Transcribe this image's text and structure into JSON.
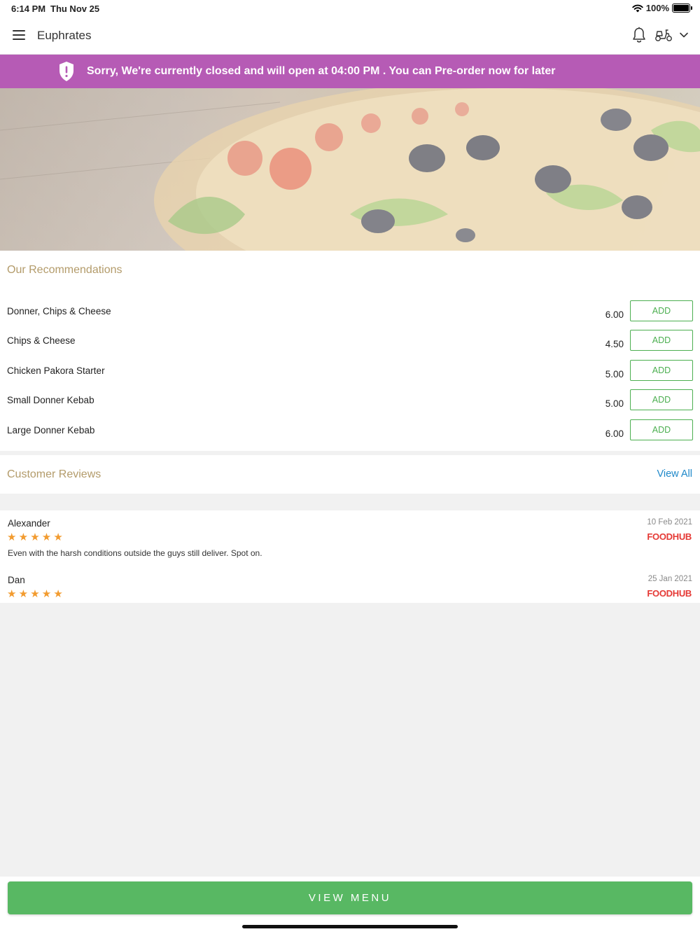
{
  "status_bar": {
    "time": "6:14 PM",
    "date": "Thu Nov 25",
    "battery": "100%"
  },
  "app_bar": {
    "title": "Euphrates"
  },
  "banner": {
    "message": "Sorry, We're currently closed and will open at 04:00 PM . You can Pre-order now for later",
    "color": "#b65bb5"
  },
  "recommendations": {
    "title": "Our Recommendations",
    "items": [
      {
        "name": "Donner, Chips & Cheese",
        "price": "6.00",
        "action": "ADD"
      },
      {
        "name": "Chips & Cheese",
        "price": "4.50",
        "action": "ADD"
      },
      {
        "name": "Chicken Pakora Starter",
        "price": "5.00",
        "action": "ADD"
      },
      {
        "name": "Small Donner Kebab",
        "price": "5.00",
        "action": "ADD"
      },
      {
        "name": "Large Donner Kebab",
        "price": "6.00",
        "action": "ADD"
      }
    ]
  },
  "reviews": {
    "title": "Customer Reviews",
    "view_all": "View All",
    "items": [
      {
        "author": "Alexander",
        "rating": 5,
        "text": "Even with the harsh conditions outside the guys still deliver. Spot on.",
        "date": "10 Feb 2021",
        "source": "FOODHUB"
      },
      {
        "author": "Dan",
        "rating": 5,
        "text": "",
        "date": "25 Jan 2021",
        "source": "FOODHUB"
      }
    ]
  },
  "footer": {
    "button": "VIEW MENU",
    "color": "#58b863"
  },
  "icons": [
    "menu-icon",
    "bell-icon",
    "scooter-icon",
    "chevron-down-icon",
    "shield-alert-icon",
    "wifi-icon",
    "battery-icon",
    "star-icon"
  ]
}
